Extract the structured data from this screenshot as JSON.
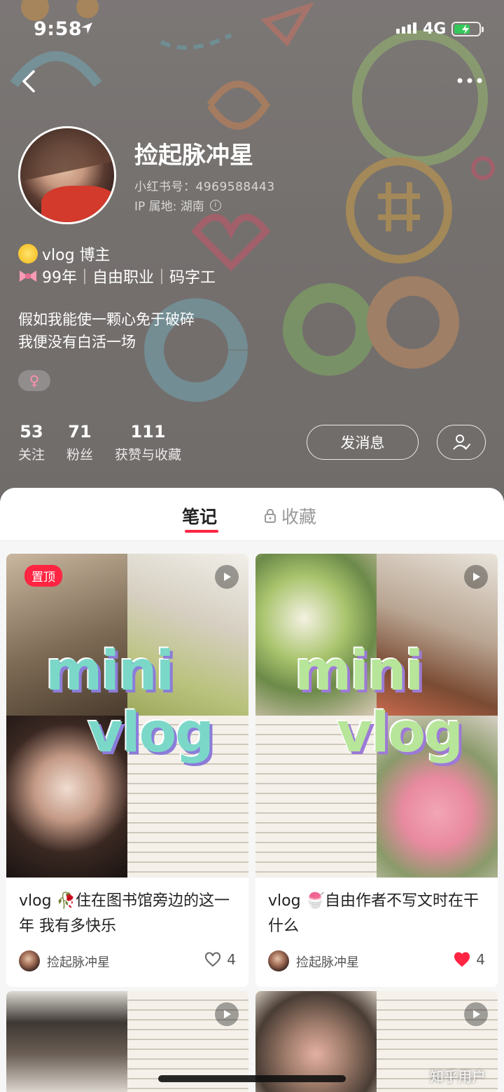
{
  "status_bar": {
    "time": "9:58",
    "network": "4G"
  },
  "profile": {
    "nickname": "捡起脉冲星",
    "red_id": "小红书号：4969588443",
    "ip_location": "IP 属地: 湖南",
    "tag_1": "vlog 博主",
    "tag_2": "99年｜自由职业｜码字工",
    "bio_line_1": "假如我能使一颗心免于破碎",
    "bio_line_2": "我便没有白活一场",
    "gender_symbol": "♀",
    "stats": [
      {
        "num": "53",
        "label": "关注"
      },
      {
        "num": "71",
        "label": "粉丝"
      },
      {
        "num": "111",
        "label": "获赞与收藏"
      }
    ],
    "message_button": "发消息"
  },
  "tabs": {
    "notes": "笔记",
    "favorites": "收藏"
  },
  "notes": [
    {
      "pinned_label": "置顶",
      "overlay_line_1": "mini",
      "overlay_line_2": "vlog",
      "title": "vlog 🥀住在图书馆旁边的这一年 我有多快乐",
      "author": "捡起脉冲星",
      "likes": "4",
      "liked": false
    },
    {
      "overlay_line_1": "mini",
      "overlay_line_2": "vlog",
      "title": "vlog 🍧自由作者不写文时在干什么",
      "author": "捡起脉冲星",
      "likes": "4",
      "liked": true
    }
  ],
  "colors": {
    "accent": "#ff2442",
    "battery": "#35c759"
  },
  "watermark": "知乎用户"
}
